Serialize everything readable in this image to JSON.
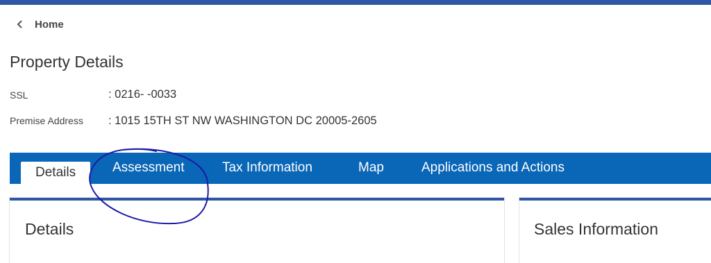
{
  "breadcrumb": {
    "home_label": "Home"
  },
  "page": {
    "title": "Property Details"
  },
  "fields": {
    "ssl": {
      "label": "SSL",
      "value": ": 0216- -0033"
    },
    "premise_address": {
      "label": "Premise Address",
      "value": ": 1015 15TH ST NW WASHINGTON DC 20005-2605"
    }
  },
  "tabs": [
    {
      "label": "Details",
      "active": true
    },
    {
      "label": "Assessment",
      "active": false
    },
    {
      "label": "Tax Information",
      "active": false
    },
    {
      "label": "Map",
      "active": false
    },
    {
      "label": "Applications and Actions",
      "active": false
    }
  ],
  "cards": {
    "details": {
      "title": "Details"
    },
    "sales": {
      "title": "Sales Information"
    }
  },
  "colors": {
    "top_bar": "#2f55a4",
    "tab_strip": "#0a66b7",
    "annotation_ink": "#1a1aa8"
  },
  "icons": {
    "back": "chevron-left-icon"
  }
}
